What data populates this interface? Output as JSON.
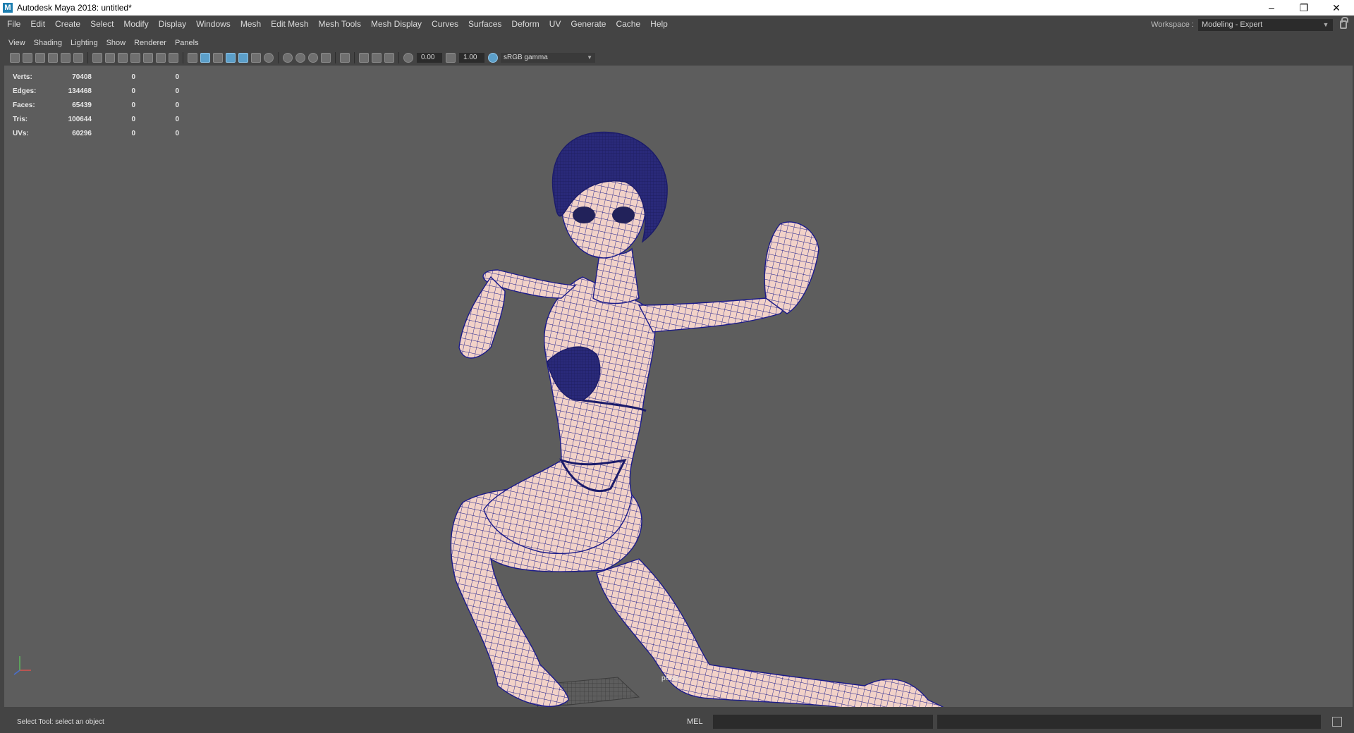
{
  "window": {
    "title": "Autodesk Maya 2018: untitled*",
    "app_icon": "M"
  },
  "window_controls": {
    "minimize": "–",
    "restore": "❐",
    "close": "✕"
  },
  "menu": [
    "File",
    "Edit",
    "Create",
    "Select",
    "Modify",
    "Display",
    "Windows",
    "Mesh",
    "Edit Mesh",
    "Mesh Tools",
    "Mesh Display",
    "Curves",
    "Surfaces",
    "Deform",
    "UV",
    "Generate",
    "Cache",
    "Help"
  ],
  "workspace": {
    "label": "Workspace :",
    "value": "Modeling - Expert"
  },
  "panel_menu": [
    "View",
    "Shading",
    "Lighting",
    "Show",
    "Renderer",
    "Panels"
  ],
  "panel_toolbar": {
    "exposure": "0.00",
    "gamma": "1.00",
    "color_space": "sRGB gamma"
  },
  "hud": {
    "rows": [
      {
        "label": "Verts:",
        "total": "70408",
        "sel": "0",
        "comp": "0"
      },
      {
        "label": "Edges:",
        "total": "134468",
        "sel": "0",
        "comp": "0"
      },
      {
        "label": "Faces:",
        "total": "65439",
        "sel": "0",
        "comp": "0"
      },
      {
        "label": "Tris:",
        "total": "100644",
        "sel": "0",
        "comp": "0"
      },
      {
        "label": "UVs:",
        "total": "60296",
        "sel": "0",
        "comp": "0"
      }
    ]
  },
  "camera_label": "persp",
  "status": {
    "help_line": "Select Tool: select an object",
    "command_language": "MEL"
  },
  "colors": {
    "viewport_bg": "#5d5d5d",
    "ui_bg": "#444444",
    "mesh_fill": "#f2d2c8",
    "wire": "#1b1b8a",
    "highlight": "#5c9fc9"
  }
}
